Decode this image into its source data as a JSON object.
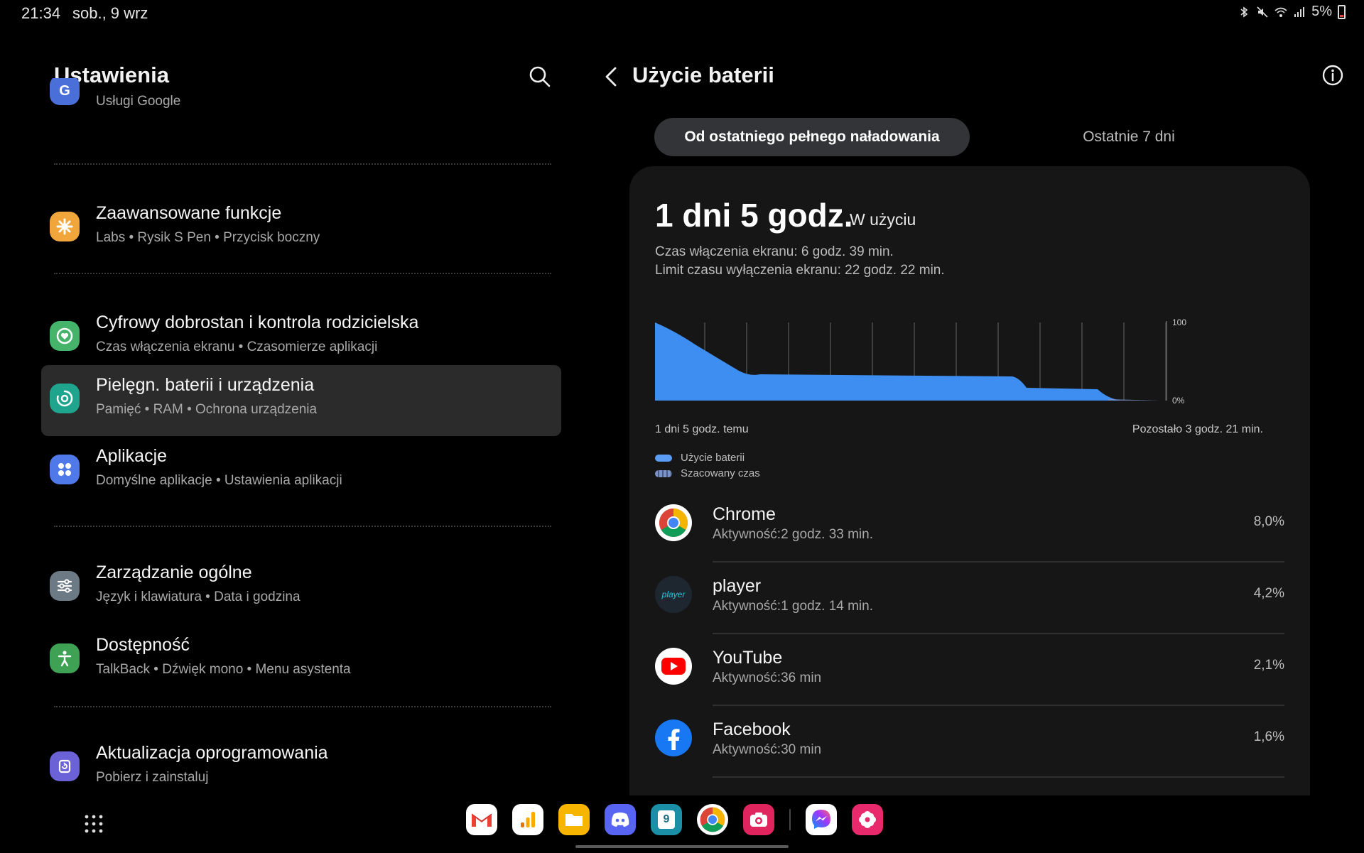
{
  "status": {
    "time": "21:34",
    "date": "sob., 9 wrz",
    "battery": "5%"
  },
  "left": {
    "title": "Ustawienia",
    "items": [
      {
        "title": "Google",
        "sub": "Usługi Google",
        "icon": "google-icon",
        "color": "#4a6fd8"
      },
      {
        "title": "Zaawansowane funkcje",
        "sub": "Labs  •  Rysik S Pen  •  Przycisk boczny",
        "icon": "star-gear-icon",
        "color": "#f0a63a"
      },
      {
        "title": "Cyfrowy dobrostan i kontrola rodzicielska",
        "sub": "Czas włączenia ekranu  •  Czasomierze aplikacji",
        "icon": "wellbeing-icon",
        "color": "#46b36a"
      },
      {
        "title": "Pielęgn. baterii i urządzenia",
        "sub": "Pamięć  •  RAM  •  Ochrona urządzenia",
        "icon": "device-care-icon",
        "color": "#1fa58e"
      },
      {
        "title": "Aplikacje",
        "sub": "Domyślne aplikacje  •  Ustawienia aplikacji",
        "icon": "apps-icon",
        "color": "#4f79e8"
      },
      {
        "title": "Zarządzanie ogólne",
        "sub": "Język i klawiatura  •  Data i godzina",
        "icon": "sliders-icon",
        "color": "#6c7a86"
      },
      {
        "title": "Dostępność",
        "sub": "TalkBack  •  Dźwięk mono  •  Menu asystenta",
        "icon": "accessibility-icon",
        "color": "#3ea154"
      },
      {
        "title": "Aktualizacja oprogramowania",
        "sub": "Pobierz i zainstaluj",
        "icon": "update-icon",
        "color": "#6b62d8"
      }
    ]
  },
  "right": {
    "title": "Użycie baterii",
    "tabs": [
      "Od ostatniego pełnego naładowania",
      "Ostatnie 7 dni"
    ],
    "usage_big": "1 dni 5 godz.",
    "usage_tag": "W użyciu",
    "screen_on": "Czas włączenia ekranu: 6 godz. 39 min.",
    "screen_off": "Limit czasu wyłączenia ekranu: 22 godz. 22 min.",
    "chart_left": "1 dni 5 godz. temu",
    "chart_right": "Pozostało 3 godz. 21 min.",
    "axis_top": "100",
    "axis_bottom": "0%",
    "legend": [
      {
        "label": "Użycie baterii",
        "color": "#5b9cf4"
      },
      {
        "label": "Szacowany czas",
        "color": "#7a93c9"
      }
    ],
    "apps": [
      {
        "name": "Chrome",
        "activity": "Aktywność:2 godz. 33 min.",
        "pct": "8,0%",
        "icon": "chrome-icon"
      },
      {
        "name": "player",
        "activity": "Aktywność:1 godz. 14 min.",
        "pct": "4,2%",
        "icon": "player-icon",
        "icon_text": "player"
      },
      {
        "name": "YouTube",
        "activity": "Aktywność:36 min",
        "pct": "2,1%",
        "icon": "youtube-icon"
      },
      {
        "name": "Facebook",
        "activity": "Aktywność:30 min",
        "pct": "1,6%",
        "icon": "facebook-icon"
      }
    ]
  },
  "dock": {
    "icons": [
      "gmail-icon",
      "analytics-icon",
      "files-icon",
      "discord-icon",
      "calendar-icon",
      "chrome-icon",
      "camera-icon",
      "messenger-icon",
      "flower-icon"
    ],
    "calendar_day": "9"
  }
}
